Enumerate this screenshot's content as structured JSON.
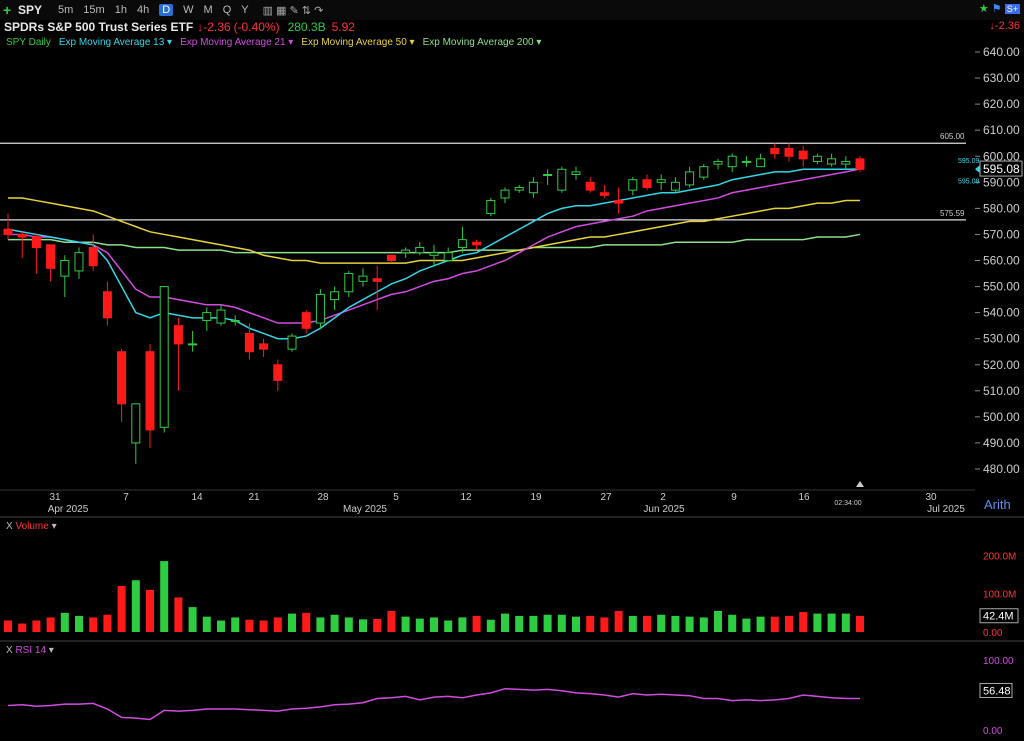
{
  "toolbar": {
    "symbol": "SPY",
    "timeframes": [
      "5m",
      "15m",
      "1h",
      "4h",
      "D",
      "W",
      "M",
      "Q",
      "Y"
    ],
    "active_timeframe": "D"
  },
  "info": {
    "title": "SPDRs S&P 500 Trust Series ETF",
    "change": "-2.36",
    "change_pct": "(-0.40%)",
    "volume": "280.3B",
    "value2": "5.92",
    "right_change": "-2.36"
  },
  "legend": [
    {
      "label": "SPY Daily",
      "color": "#2ecc40"
    },
    {
      "label": "Exp Moving Average 13",
      "color": "#33d6e6"
    },
    {
      "label": "Exp Moving Average 21",
      "color": "#d24be0"
    },
    {
      "label": "Exp Moving Average 50",
      "color": "#e8d23a"
    },
    {
      "label": "Exp Moving Average 200",
      "color": "#8be08b"
    }
  ],
  "price_axis": {
    "ticks": [
      "640.00",
      "630.00",
      "620.00",
      "610.00",
      "600.00",
      "590.00",
      "580.00",
      "570.00",
      "560.00",
      "550.00",
      "540.00",
      "530.00",
      "520.00",
      "510.00",
      "500.00",
      "490.00",
      "480.00"
    ],
    "last_price": "595.08",
    "ema13_label": "595.09",
    "ema21_label": "595.08",
    "scale_mode": "Arith"
  },
  "hlines": [
    {
      "label": "605.00",
      "value": 605
    },
    {
      "label": "575.59",
      "value": 575.59
    }
  ],
  "date_axis": {
    "labels": [
      "31",
      "Apr 2025",
      "7",
      "14",
      "21",
      "28",
      "May 2025",
      "5",
      "12",
      "19",
      "27",
      "2",
      "Jun 2025",
      "9",
      "16",
      "30",
      "Jul 2025"
    ],
    "time_label": "02:34:00"
  },
  "volume_panel": {
    "title": "Volume",
    "ticks": [
      "200.0M",
      "100.0M",
      "0.00"
    ],
    "last_value": "42.4M"
  },
  "rsi_panel": {
    "title": "RSI 14",
    "ticks": [
      "100.00",
      "0.00"
    ],
    "last_value": "56.48"
  },
  "chart_data": {
    "type": "candlestick",
    "candles": [
      [
        572,
        578,
        568,
        570
      ],
      [
        570,
        571,
        561,
        569
      ],
      [
        569,
        570,
        555,
        565
      ],
      [
        566,
        566,
        552,
        557
      ],
      [
        554,
        562,
        546,
        560
      ],
      [
        556,
        565,
        553,
        563
      ],
      [
        565,
        570,
        556,
        558
      ],
      [
        548,
        552,
        535,
        538
      ],
      [
        525,
        526,
        498,
        505
      ],
      [
        490,
        504,
        482,
        505
      ],
      [
        525,
        528,
        488,
        495
      ],
      [
        496,
        550,
        494,
        550
      ],
      [
        535,
        538,
        510,
        528
      ],
      [
        528,
        533,
        525,
        528
      ],
      [
        537,
        542,
        533,
        540
      ],
      [
        536,
        543,
        535,
        541
      ],
      [
        537,
        539,
        535,
        537
      ],
      [
        532,
        536,
        522,
        525
      ],
      [
        528,
        530,
        523,
        526
      ],
      [
        520,
        522,
        510,
        514
      ],
      [
        526,
        532,
        525,
        531
      ],
      [
        540,
        541,
        532,
        534
      ],
      [
        536,
        549,
        534,
        547
      ],
      [
        545,
        550,
        541,
        548
      ],
      [
        548,
        556,
        546,
        555
      ],
      [
        552,
        557,
        550,
        554
      ],
      [
        553,
        558,
        541,
        552
      ],
      [
        562,
        562,
        559,
        560
      ],
      [
        563,
        565,
        561,
        564
      ],
      [
        563,
        567,
        562,
        565
      ],
      [
        562,
        566,
        558,
        563
      ],
      [
        560,
        565,
        560,
        563
      ],
      [
        565,
        573,
        563,
        568
      ],
      [
        567,
        568,
        564,
        566
      ],
      [
        578,
        584,
        577,
        583
      ],
      [
        584,
        588,
        582,
        587
      ],
      [
        587,
        589,
        586,
        588
      ],
      [
        586,
        592,
        584,
        590
      ],
      [
        593,
        595,
        589,
        593
      ],
      [
        587,
        596,
        586,
        595
      ],
      [
        593,
        596,
        591,
        594
      ],
      [
        590,
        592,
        586,
        587
      ],
      [
        586,
        589,
        584,
        585
      ],
      [
        583,
        588,
        578,
        582
      ],
      [
        587,
        592,
        585,
        591
      ],
      [
        591,
        593,
        587,
        588
      ],
      [
        590,
        593,
        587,
        591
      ],
      [
        587,
        592,
        586,
        590
      ],
      [
        589,
        596,
        588,
        594
      ],
      [
        592,
        597,
        591,
        596
      ],
      [
        597,
        599,
        595,
        598
      ],
      [
        596,
        601,
        594,
        600
      ],
      [
        598,
        600,
        596,
        598
      ],
      [
        596,
        601,
        596,
        599
      ],
      [
        603,
        605,
        599,
        601
      ],
      [
        603,
        605,
        598,
        600
      ],
      [
        602,
        604,
        596,
        599
      ],
      [
        598,
        601,
        597,
        600
      ],
      [
        597,
        601,
        596,
        599
      ],
      [
        597,
        600,
        595,
        598
      ],
      [
        599,
        600,
        594,
        595
      ]
    ],
    "ema13": [
      572,
      571,
      570,
      569,
      568,
      567,
      566,
      560,
      550,
      540,
      538,
      540,
      539,
      538,
      538,
      538,
      537,
      534,
      532,
      530,
      530,
      531,
      534,
      538,
      542,
      545,
      548,
      551,
      553,
      556,
      558,
      560,
      562,
      563,
      566,
      569,
      572,
      575,
      578,
      580,
      581,
      581,
      582,
      583,
      584,
      585,
      586,
      586,
      587,
      588,
      589,
      591,
      592,
      593,
      594,
      594,
      595,
      595,
      595,
      595,
      595.09
    ],
    "ema21": [
      570,
      570,
      569,
      569,
      568,
      567,
      566,
      563,
      556,
      549,
      546,
      546,
      545,
      544,
      543,
      543,
      542,
      540,
      538,
      536,
      536,
      536,
      537,
      539,
      541,
      543,
      545,
      547,
      548,
      550,
      552,
      553,
      555,
      556,
      558,
      560,
      563,
      566,
      569,
      571,
      573,
      574,
      575,
      576,
      577,
      579,
      580,
      581,
      582,
      583,
      584,
      586,
      587,
      588,
      589,
      590,
      591,
      592,
      593,
      594,
      595.08
    ],
    "ema50": [
      584,
      584,
      583,
      582,
      581,
      580,
      579,
      577,
      575,
      573,
      571,
      570,
      569,
      568,
      567,
      566,
      565,
      564,
      562,
      561,
      560,
      560,
      559,
      559,
      559,
      559,
      559,
      559,
      559,
      560,
      560,
      560,
      560,
      561,
      562,
      563,
      564,
      565,
      566,
      567,
      568,
      569,
      569,
      570,
      571,
      572,
      573,
      574,
      575,
      575,
      576,
      577,
      578,
      579,
      580,
      580,
      581,
      582,
      582,
      583,
      583
    ],
    "ema200": [
      568,
      568,
      568,
      568,
      567,
      567,
      567,
      566,
      566,
      565,
      565,
      565,
      564,
      564,
      564,
      564,
      563,
      563,
      563,
      563,
      563,
      563,
      563,
      563,
      563,
      563,
      563,
      563,
      563,
      563,
      563,
      563,
      564,
      564,
      564,
      564,
      564,
      565,
      565,
      565,
      565,
      565,
      566,
      566,
      566,
      566,
      566,
      567,
      567,
      567,
      567,
      567,
      568,
      568,
      568,
      568,
      568,
      569,
      569,
      569,
      570
    ],
    "volume_m": [
      30,
      22,
      30,
      38,
      50,
      42,
      38,
      45,
      120,
      135,
      110,
      185,
      90,
      65,
      40,
      30,
      38,
      32,
      30,
      38,
      48,
      50,
      38,
      45,
      38,
      33,
      34,
      55,
      40,
      35,
      38,
      30,
      38,
      42,
      32,
      48,
      42,
      42,
      45,
      45,
      40,
      42,
      38,
      55,
      42,
      42,
      45,
      42,
      40,
      38,
      55,
      45,
      35,
      40,
      40,
      42,
      52,
      48,
      48,
      48,
      42
    ],
    "rsi": [
      35,
      36,
      34,
      35,
      37,
      37,
      38,
      30,
      18,
      17,
      15,
      28,
      27,
      28,
      30,
      30,
      30,
      29,
      28,
      27,
      30,
      31,
      33,
      36,
      37,
      39,
      45,
      46,
      48,
      43,
      47,
      48,
      46,
      50,
      53,
      59,
      58,
      57,
      58,
      56,
      53,
      52,
      50,
      47,
      52,
      50,
      51,
      50,
      49,
      45,
      45,
      42,
      43,
      42,
      43,
      45,
      50,
      48,
      46,
      45,
      45
    ]
  }
}
